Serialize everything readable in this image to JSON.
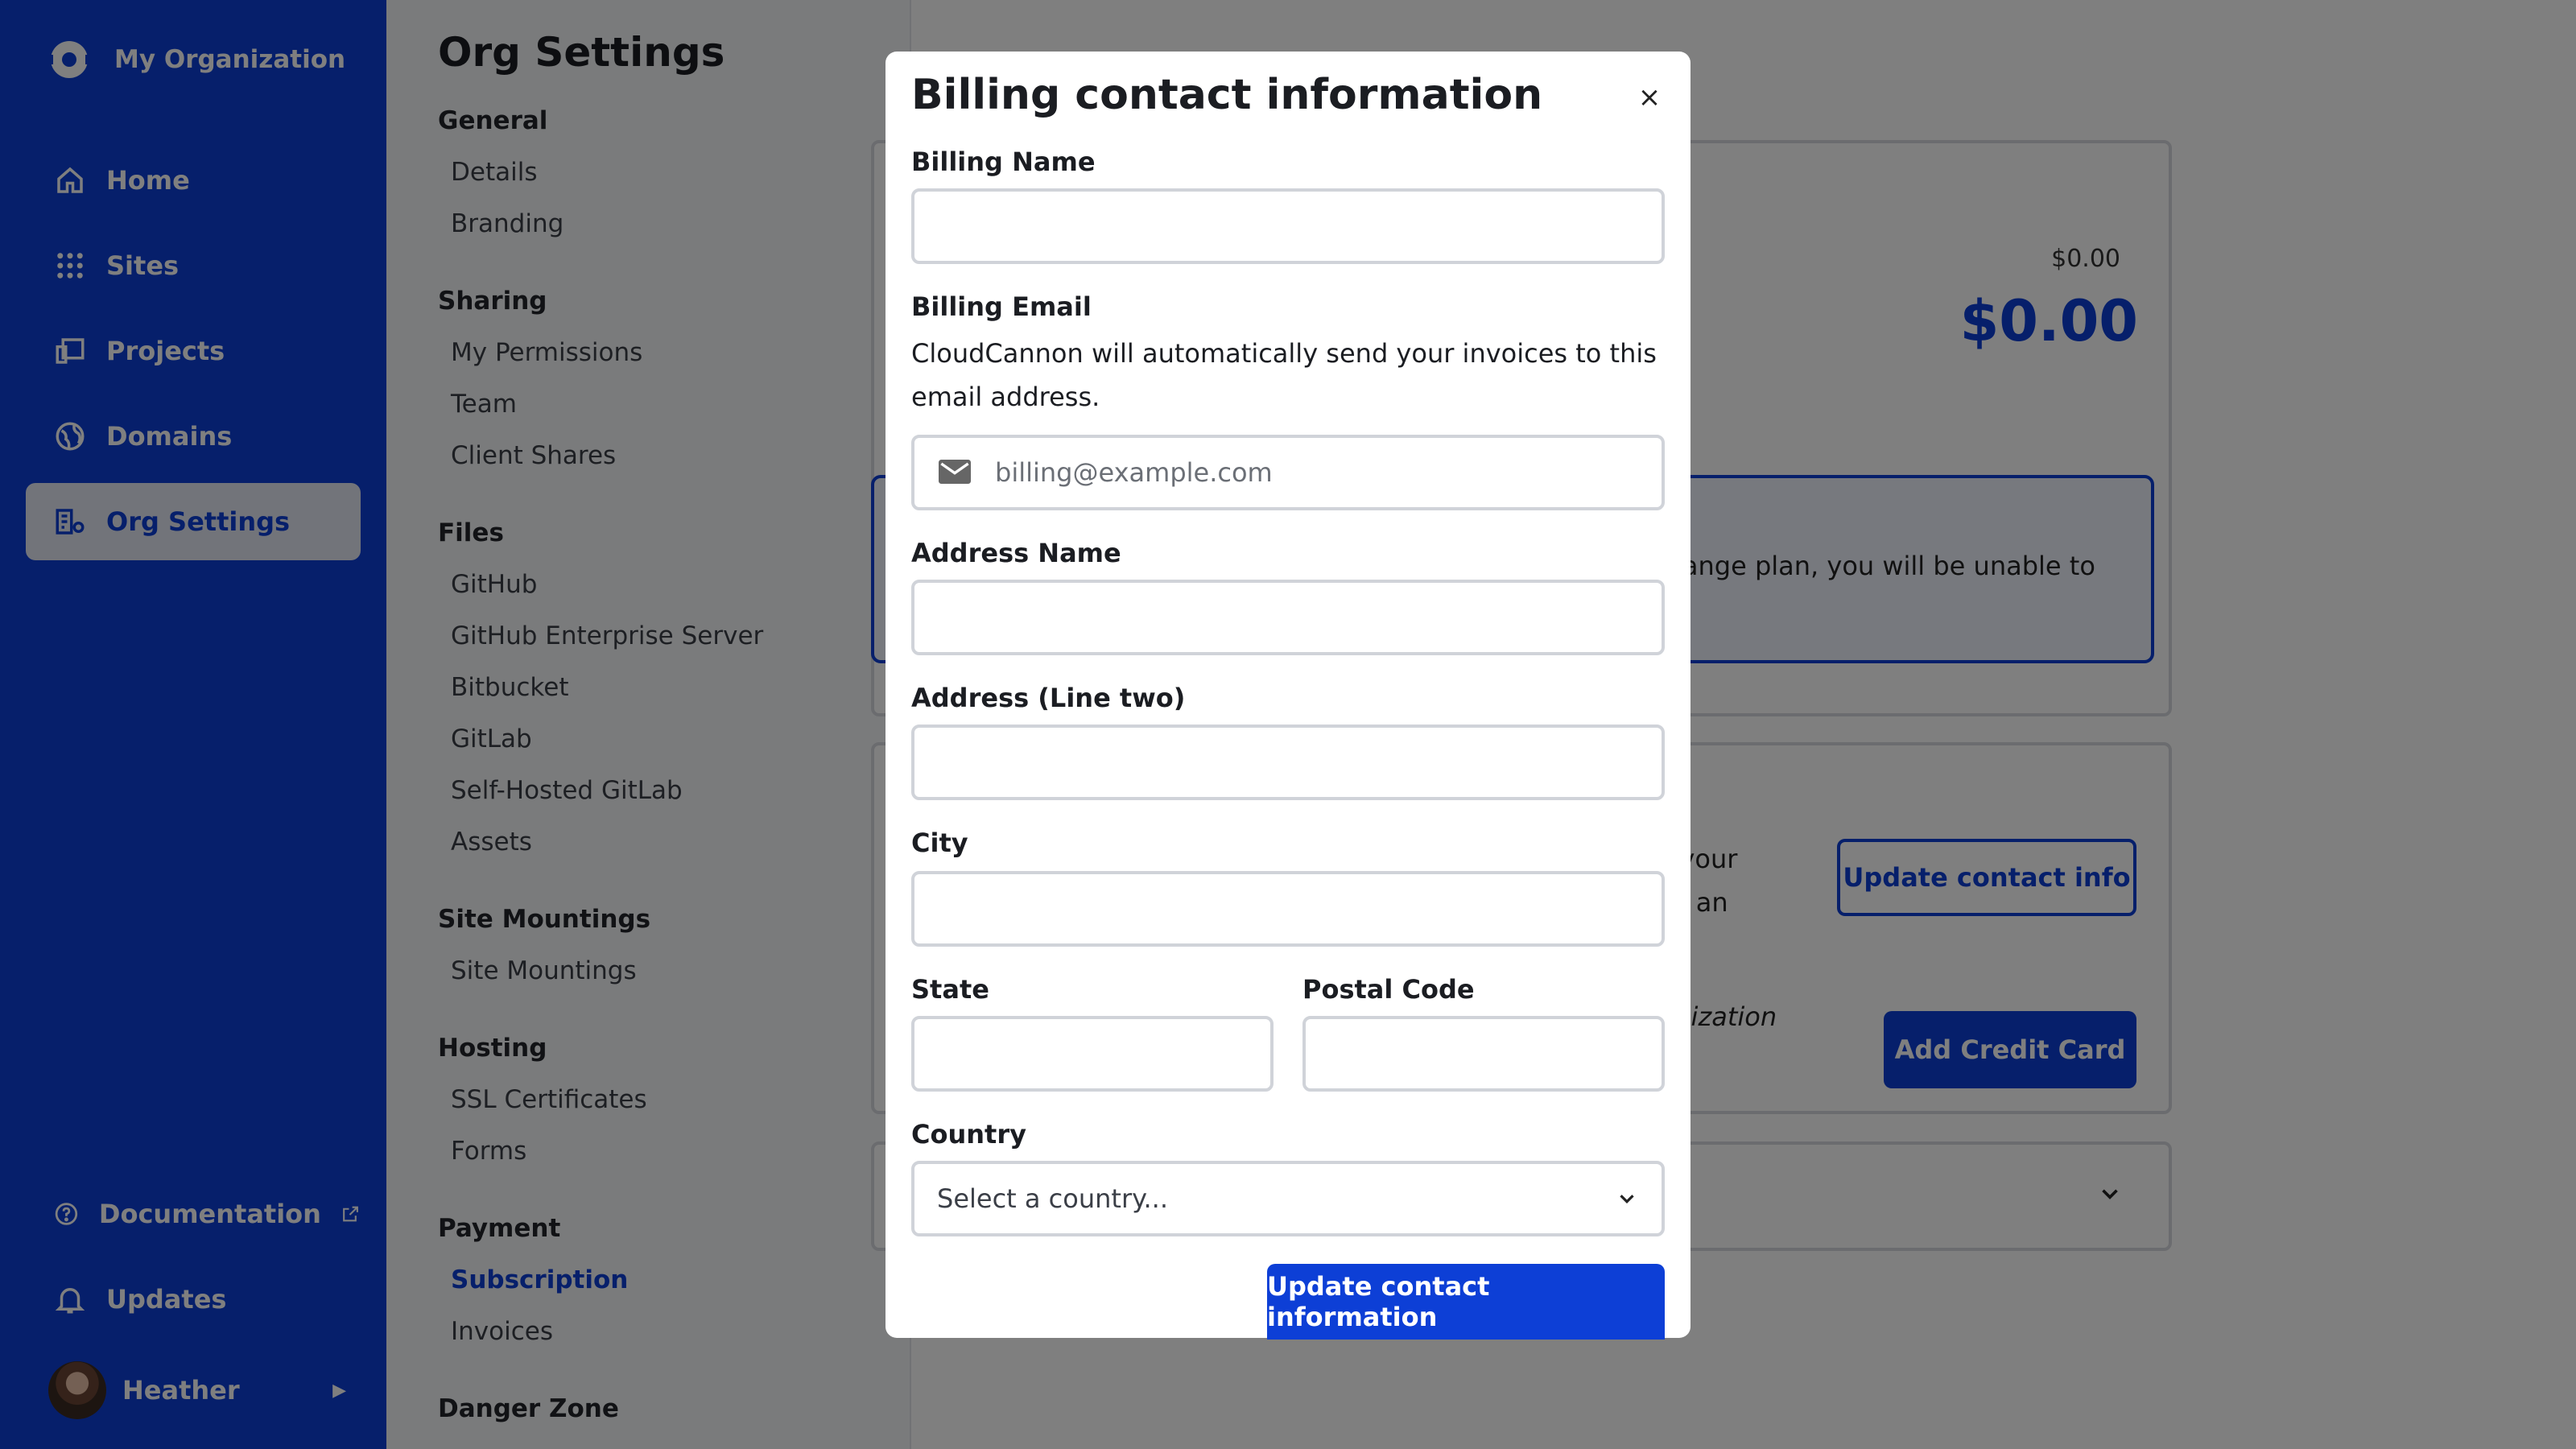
{
  "org": {
    "name": "My Organization"
  },
  "nav": [
    {
      "label": "Home",
      "icon": "home-icon"
    },
    {
      "label": "Sites",
      "icon": "grid-icon"
    },
    {
      "label": "Projects",
      "icon": "projects-icon"
    },
    {
      "label": "Domains",
      "icon": "globe-icon"
    },
    {
      "label": "Org Settings",
      "icon": "org-settings-icon",
      "active": true
    }
  ],
  "sidebar_bottom": {
    "documentation": "Documentation",
    "updates": "Updates",
    "user": "Heather"
  },
  "settings": {
    "title": "Org Settings",
    "groups": [
      {
        "title": "General",
        "items": [
          "Details",
          "Branding"
        ]
      },
      {
        "title": "Sharing",
        "items": [
          "My Permissions",
          "Team",
          "Client Shares"
        ]
      },
      {
        "title": "Files",
        "items": [
          "GitHub",
          "GitHub Enterprise Server",
          "Bitbucket",
          "GitLab",
          "Self-Hosted GitLab",
          "Assets"
        ]
      },
      {
        "title": "Site Mountings",
        "items": [
          "Site Mountings"
        ]
      },
      {
        "title": "Hosting",
        "items": [
          "SSL Certificates",
          "Forms"
        ]
      },
      {
        "title": "Payment",
        "items": [
          "Subscription",
          "Invoices"
        ]
      },
      {
        "title": "Danger Zone",
        "items": []
      }
    ],
    "active_item": "Subscription"
  },
  "main": {
    "price_small": "$0.00",
    "price_big": "$0.00",
    "notice_text": "change plan, you will be unable to",
    "contact_frag_1": "n your",
    "contact_frag_2": "dd an",
    "org_frag": "Organization",
    "update_contact_button": "Update contact info",
    "add_card_button": "Add Credit Card"
  },
  "modal": {
    "title": "Billing contact information",
    "close_label": "×",
    "billing_name_label": "Billing Name",
    "billing_email_label": "Billing Email",
    "billing_email_help": "CloudCannon will automatically send your invoices to this email address.",
    "billing_email_placeholder": "billing@example.com",
    "address_name_label": "Address Name",
    "address_line_two_label": "Address (Line two)",
    "city_label": "City",
    "state_label": "State",
    "postal_code_label": "Postal Code",
    "country_label": "Country",
    "country_select_value": "Select a country...",
    "submit_label": "Update contact information"
  },
  "colors": {
    "accent": "#0d3fd6",
    "overlay": "rgba(0,0,0,0.5)"
  }
}
